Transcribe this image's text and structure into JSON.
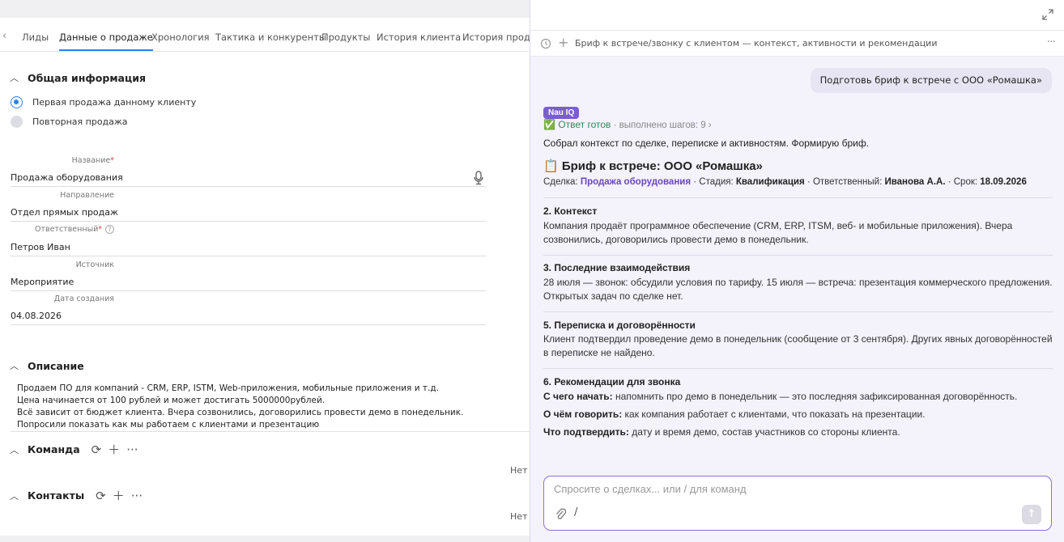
{
  "tabs": [
    "Лиды",
    "Данные о продаже",
    "Хронология",
    "Тактика и конкуренты",
    "Продукты",
    "История клиента",
    "История продаж"
  ],
  "general": {
    "title": "Общая информация",
    "radio_first": "Первая продажа данному клиенту",
    "radio_repeat": "Повторная продажа"
  },
  "fields": [
    {
      "label": "Название",
      "value": "Продажа оборудования"
    },
    {
      "label": "Направление",
      "value": "Отдел прямых продаж"
    },
    {
      "label": "Ответственный",
      "value": "Петров Иван"
    },
    {
      "label": "Источник",
      "value": "Мероприятие"
    },
    {
      "label": "Дата создания",
      "value": "04.08.2026"
    }
  ],
  "required_mark": "*",
  "help_mark": "?",
  "description": {
    "title": "Описание",
    "lines": [
      "Продаем ПО для компаний - CRM, ERP, ISTM, Web-приложения, мобильные приложения и т.д.",
      "Цена начинается от 100 рублей и может достигать 5000000рублей.",
      "Всё зависит от бюджет клиента. Вчера созвонились, договорились провести демо в понедельник.",
      "Попросили показать как мы работаем с клиентами и презентацию"
    ]
  },
  "team": {
    "title": "Команда",
    "empty": "Нет"
  },
  "contacts": {
    "title": "Контакты",
    "empty": "Нет"
  },
  "assistant": {
    "toolbar_title": "Бриф к встрече/звонку с клиентом — контекст, активности и рекомендации",
    "more": "···",
    "user_message": "Подготовь бриф к встрече с ООО «Ромашка»",
    "badge": "Nau IQ",
    "status": "✅ Ответ готов",
    "steps": " · выполнено шагов: 9 ›",
    "intro": "Собрал контекст по сделке, переписке и активностям. Формирую бриф.",
    "brief_title": "📋 Бриф к встрече: ООО «Ромашка»",
    "meta": {
      "deal_label": "Сделка: ",
      "deal": "Продажа оборудования",
      "stage_label": " · Стадия: ",
      "stage": "Квалификация",
      "owner_label": " · Ответственный: ",
      "owner": "Иванова А.А.",
      "due_label": " · Срок: ",
      "due": "18.09.2026"
    },
    "sections": [
      {
        "title": "2. Контекст",
        "text": "Компания продаёт программное обеспечение (CRM, ERP, ITSM, веб- и мобильные приложения). Вчера созвонились, договорились провести демо в понедельник."
      },
      {
        "title": "3. Последние взаимодействия",
        "text": "28 июля — звонок: обсудили условия по тарифу. 15 июля — встреча: презентация коммерческого предложения. Открытых задач по сделке нет."
      },
      {
        "title": "5. Переписка и договорённости",
        "text": "Клиент подтвердил проведение демо в понедельник (сообщение от 3 сентября). Других явных договорённостей в переписке не найдено."
      }
    ],
    "recommendations": {
      "title": "6. Рекомендации для звонка",
      "items": [
        {
          "label": "С чего начать:",
          "text": " напомнить про демо в понедельник — это последняя зафиксированная договорённость."
        },
        {
          "label": "О чём говорить:",
          "text": " как компания работает с клиентами, что показать на презентации."
        },
        {
          "label": "Что подтвердить:",
          "text": " дату и время демо, состав участников со стороны клиента."
        }
      ]
    },
    "input_placeholder": "Спросите о сделках... или / для команд",
    "slash": "/",
    "send": "↑"
  }
}
